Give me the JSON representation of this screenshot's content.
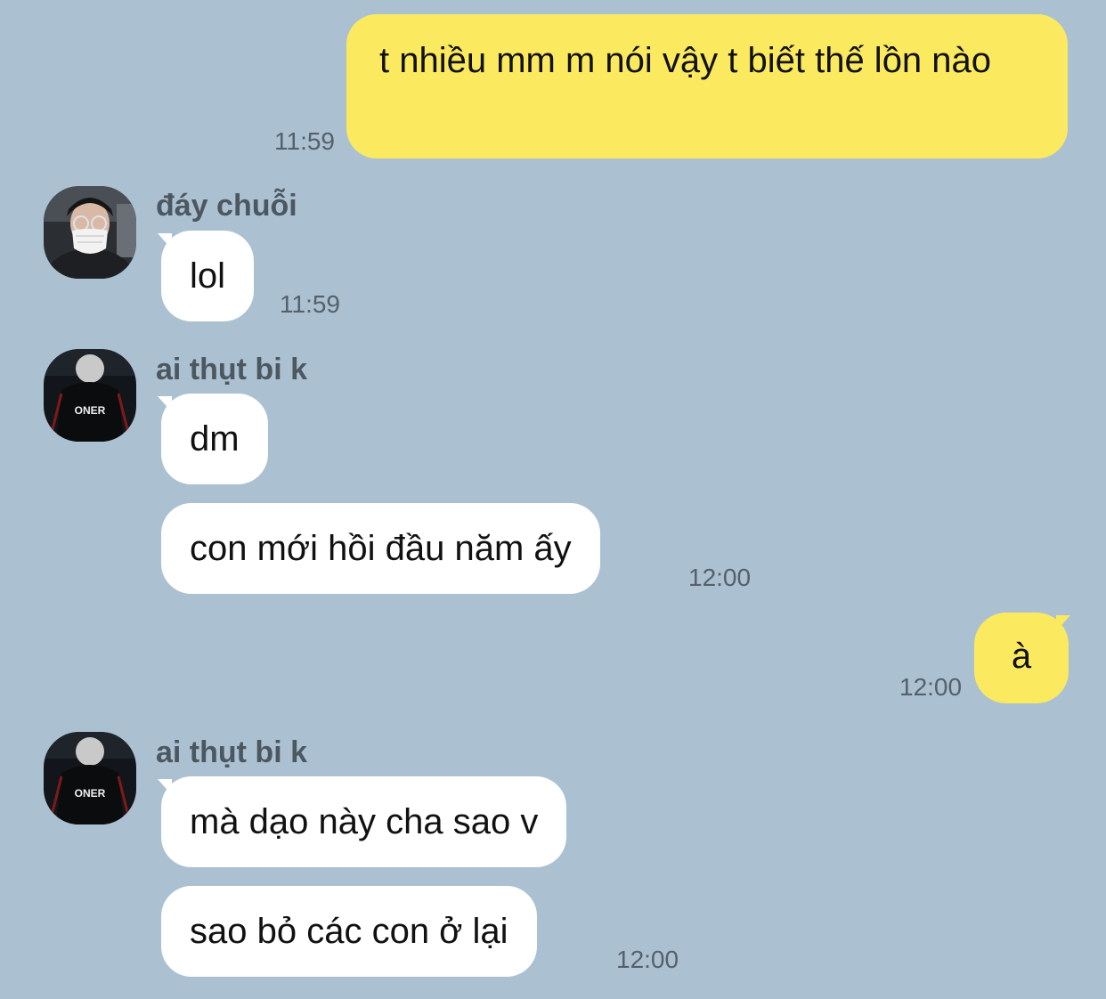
{
  "conversation": {
    "messages": [
      {
        "from": "me",
        "text": "t nhiều mm m nói vậy t biết thế lồn nào",
        "time": "11:59"
      },
      {
        "from": "them",
        "sender": "đáy chuỗi",
        "avatar_icon": "masked-person-avatar",
        "text": "lol",
        "time": "11:59"
      },
      {
        "from": "them",
        "sender": "ai thụt bi k",
        "avatar_icon": "oner-jersey-avatar",
        "text": "dm"
      },
      {
        "from": "them",
        "text": "con mới hồi đầu năm ấy",
        "time": "12:00"
      },
      {
        "from": "me",
        "text": "à",
        "time": "12:00"
      },
      {
        "from": "them",
        "sender": "ai thụt bi k",
        "avatar_icon": "oner-jersey-avatar",
        "text": "mà dạo này cha sao v"
      },
      {
        "from": "them",
        "text": "sao bỏ các con ở lại",
        "time": "12:00"
      }
    ],
    "avatar_text": "ONER"
  },
  "colors": {
    "background": "#abc1d1",
    "my_bubble": "#fbe960",
    "their_bubble": "#ffffff",
    "timestamp": "#55606a",
    "sender_name": "#4d5760"
  }
}
